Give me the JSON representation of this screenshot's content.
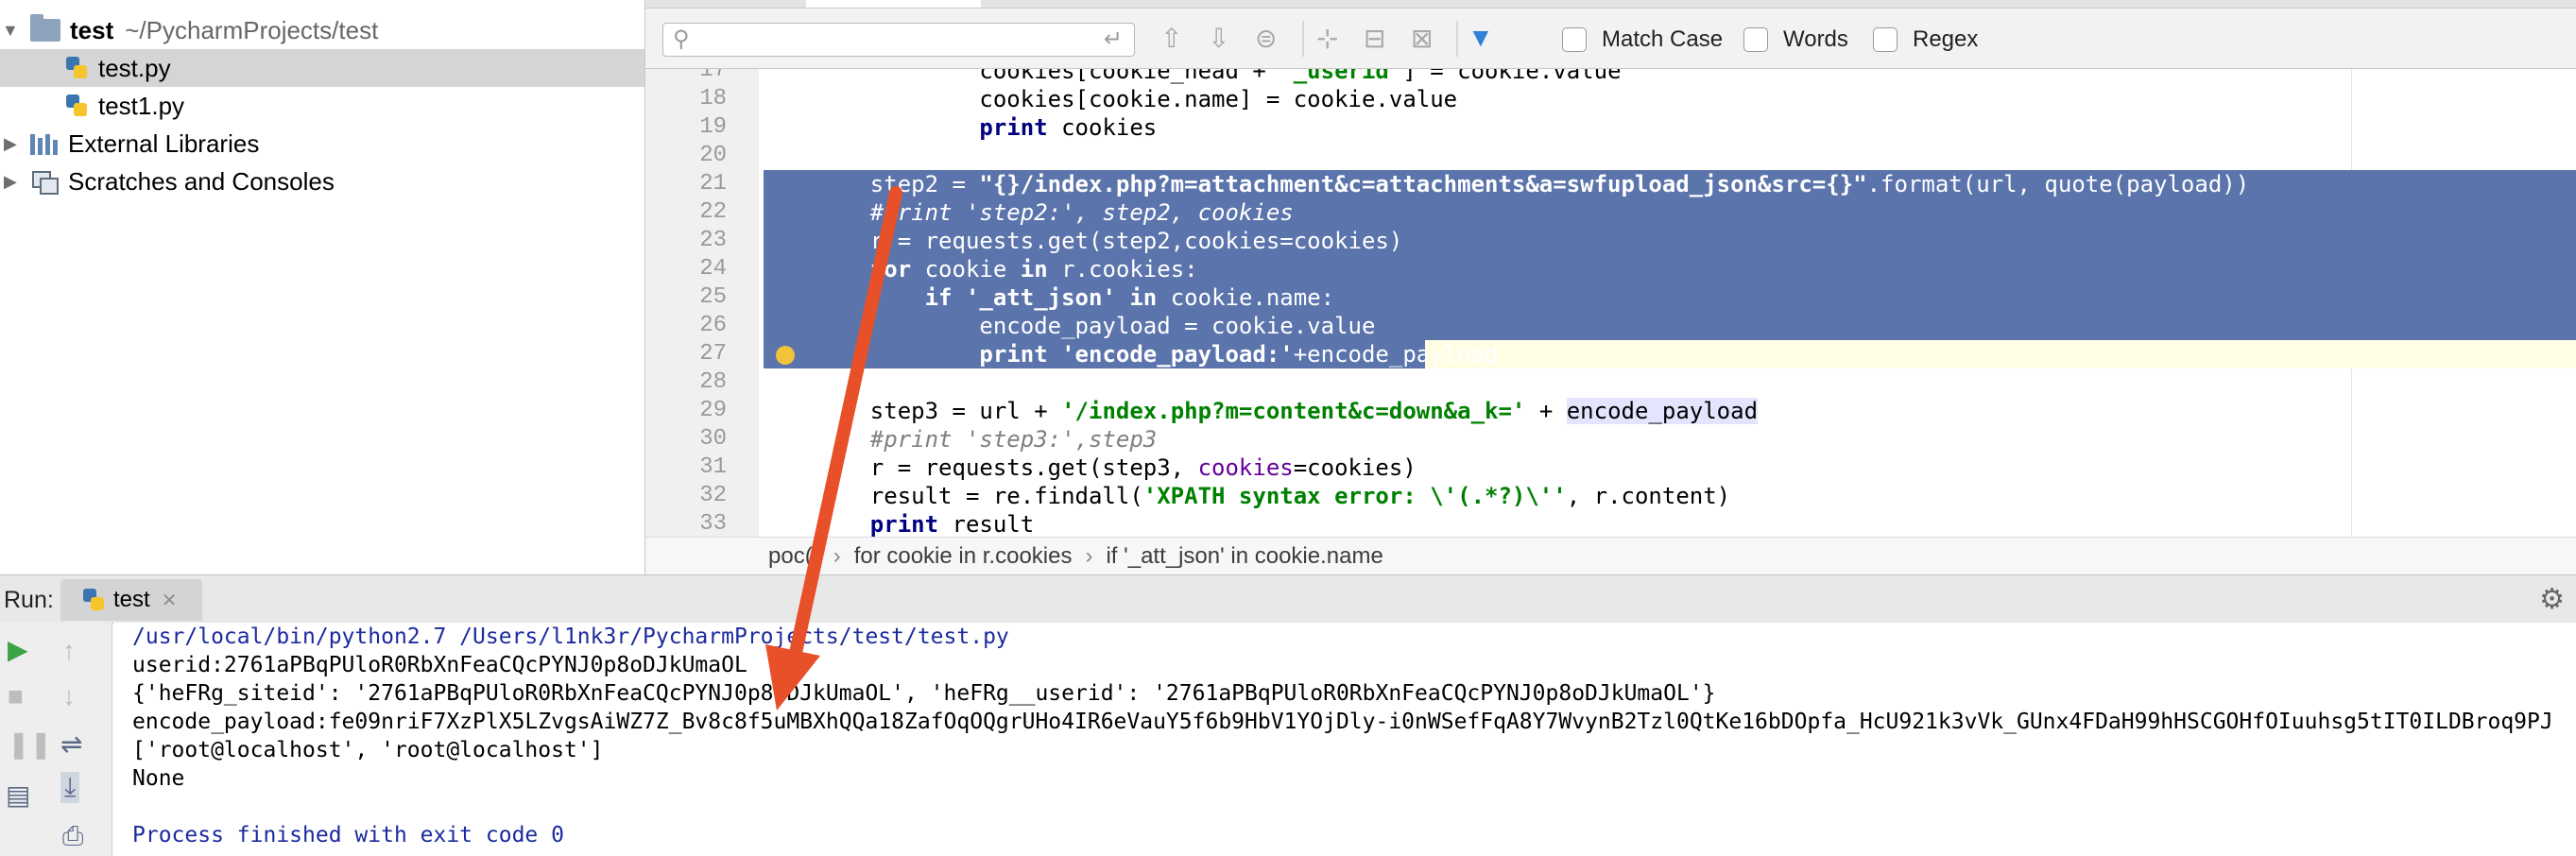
{
  "project": {
    "root_name": "test",
    "root_path": "~/PycharmProjects/test",
    "files": [
      "test.py",
      "test1.py"
    ],
    "ext_libs": "External Libraries",
    "scratches": "Scratches and Consoles"
  },
  "search": {
    "placeholder": "",
    "options": [
      "Match Case",
      "Words",
      "Regex"
    ]
  },
  "editor": {
    "line_numbers": [
      "17",
      "18",
      "19",
      "20",
      "21",
      "22",
      "23",
      "24",
      "25",
      "26",
      "27",
      "28",
      "29",
      "30",
      "31",
      "32",
      "33"
    ],
    "breadcrumb": [
      "poc()",
      "for cookie in r.cookies",
      "if '_att_json' in cookie.name"
    ]
  },
  "run": {
    "label": "Run:",
    "tab": "test",
    "output": [
      "/usr/local/bin/python2.7 /Users/l1nk3r/PycharmProjects/test/test.py",
      "userid:2761aPBqPUloR0RbXnFeaCQcPYNJ0p8oDJkUmaOL",
      "{'heFRg_siteid': '2761aPBqPUloR0RbXnFeaCQcPYNJ0p8oDJkUmaOL', 'heFRg__userid': '2761aPBqPUloR0RbXnFeaCQcPYNJ0p8oDJkUmaOL'}",
      "encode_payload:fe09nriF7XzPlX5LZvgsAiWZ7Z_Bv8c8f5uMBXhQQa18ZafOqOQgrUHo4IR6eVauY5f6b9HbV1YOjDly-i0nWSefFqA8Y7WvynB2Tzl0QtKe16bDOpfa_HcU921k3vVk_GUnx4FDaH99hHSCGOHfOIuuhsg5tIT0ILDBroq9PJ",
      "['root@localhost', 'root@localhost']",
      "None",
      "",
      "Process finished with exit code 0"
    ]
  },
  "colors": {
    "selection": "#5b74ab",
    "arrow": "#e8502a",
    "keyword": "#000080",
    "string": "#008000"
  }
}
